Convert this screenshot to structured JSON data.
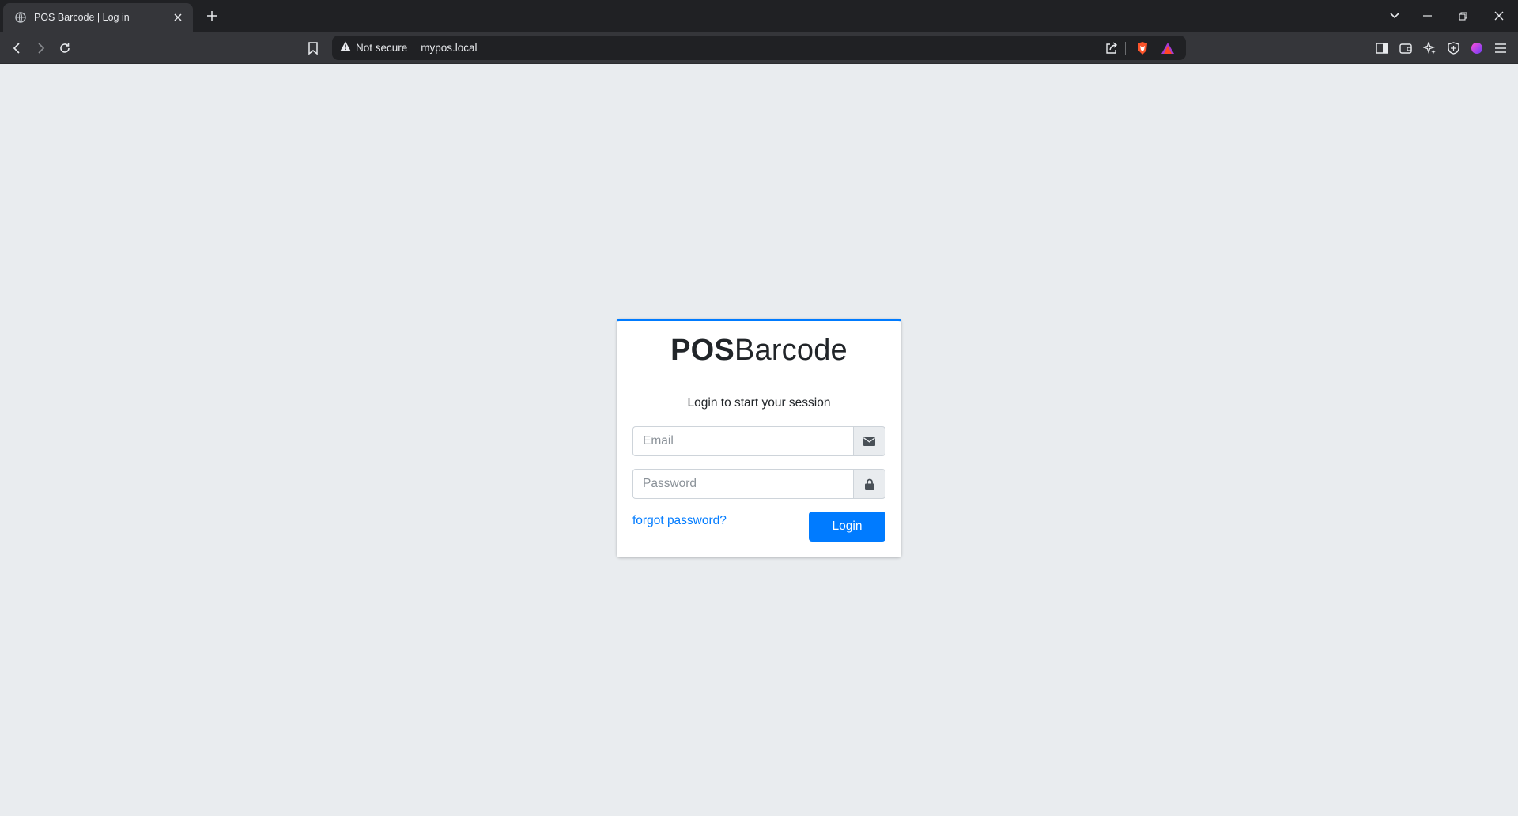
{
  "browser": {
    "tab": {
      "title": "POS Barcode | Log in",
      "favicon": "globe-icon"
    },
    "security_label": "Not secure",
    "url": "mypos.local",
    "icons": [
      "back-icon",
      "forward-icon",
      "reload-icon",
      "bookmark-icon",
      "warning-icon",
      "share-icon",
      "brave-shield-icon",
      "brave-rewards-icon",
      "sidebar-icon",
      "wallet-icon",
      "leo-ai-icon",
      "vpn-icon",
      "profile-icon",
      "menu-icon"
    ]
  },
  "login": {
    "logo_bold": "POS",
    "logo_regular": "Barcode",
    "message": "Login to start your session",
    "email_placeholder": "Email",
    "password_placeholder": "Password",
    "forgot_link": "forgot password?",
    "submit_label": "Login"
  },
  "colors": {
    "primary": "#007bff",
    "page_bg": "#e9ecef",
    "chrome_dark": "#202124",
    "chrome_toolbar": "#35363a"
  }
}
